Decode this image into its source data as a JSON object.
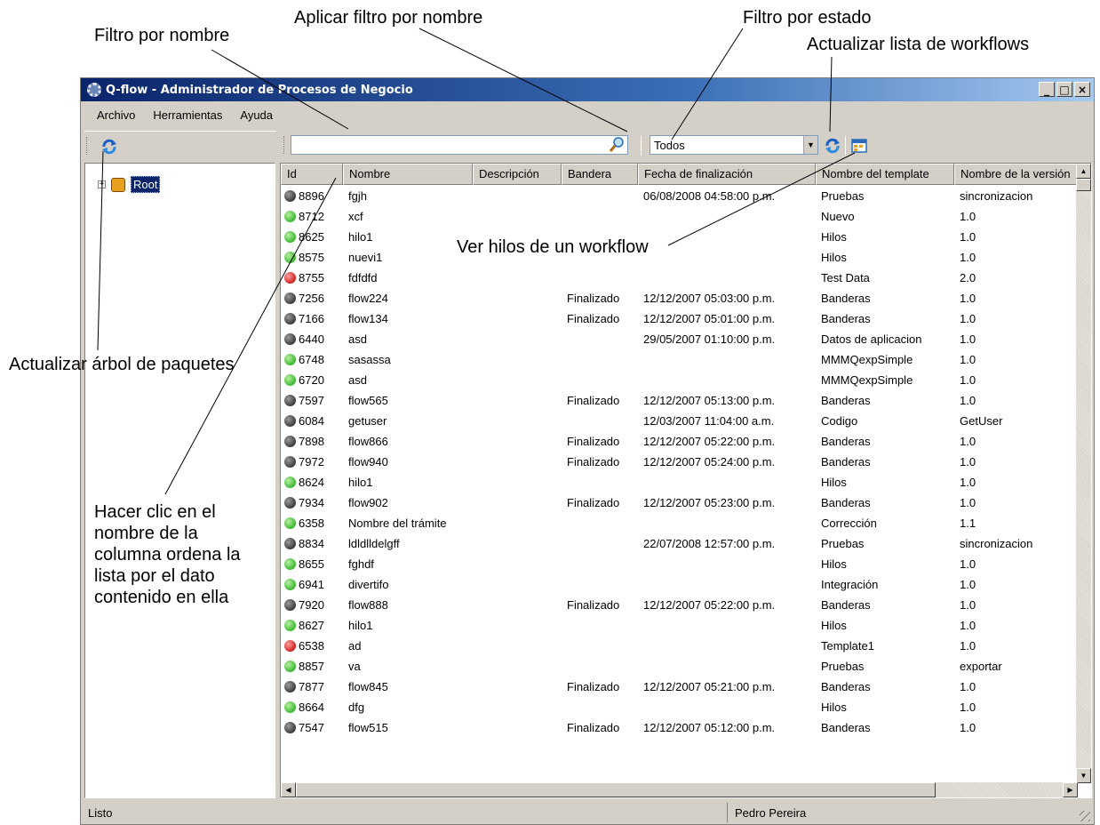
{
  "annotations": {
    "filter_by_name": "Filtro por nombre",
    "apply_name_filter": "Aplicar filtro por nombre",
    "filter_by_state": "Filtro por estado",
    "refresh_workflows": "Actualizar lista de workflows",
    "view_threads": "Ver hilos de un workflow",
    "refresh_tree": "Actualizar árbol de paquetes",
    "sort_hint": "Hacer clic en el nombre de la columna ordena la lista por el dato contenido en ella"
  },
  "window": {
    "title": "Q-flow - Administrador de Procesos de Negocio",
    "buttons": [
      "_",
      "□",
      "×"
    ]
  },
  "menu": [
    "Archivo",
    "Herramientas",
    "Ayuda"
  ],
  "toolbar": {
    "filter_value": "",
    "state_selected": "Todos"
  },
  "tree": {
    "root_label": "Root"
  },
  "grid": {
    "columns": [
      "Id",
      "Nombre",
      "Descripción",
      "Bandera",
      "Fecha de finalización",
      "Nombre del template",
      "Nombre de la versión"
    ],
    "rows": [
      {
        "status": "gray",
        "id": "8896",
        "nombre": "fgjh",
        "descripcion": "",
        "bandera": "",
        "fecha": "06/08/2008 04:58:00 p.m.",
        "template": "Pruebas",
        "version": "sincronizacion"
      },
      {
        "status": "green",
        "id": "8712",
        "nombre": "xcf",
        "descripcion": "",
        "bandera": "",
        "fecha": "",
        "template": "Nuevo",
        "version": "1.0"
      },
      {
        "status": "green",
        "id": "8625",
        "nombre": "hilo1",
        "descripcion": "",
        "bandera": "",
        "fecha": "",
        "template": "Hilos",
        "version": "1.0"
      },
      {
        "status": "green",
        "id": "8575",
        "nombre": "nuevi1",
        "descripcion": "",
        "bandera": "",
        "fecha": "",
        "template": "Hilos",
        "version": "1.0"
      },
      {
        "status": "red",
        "id": "8755",
        "nombre": "fdfdfd",
        "descripcion": "",
        "bandera": "",
        "fecha": "",
        "template": "Test Data",
        "version": "2.0"
      },
      {
        "status": "gray",
        "id": "7256",
        "nombre": "flow224",
        "descripcion": "",
        "bandera": "Finalizado",
        "fecha": "12/12/2007 05:03:00 p.m.",
        "template": "Banderas",
        "version": "1.0"
      },
      {
        "status": "gray",
        "id": "7166",
        "nombre": "flow134",
        "descripcion": "",
        "bandera": "Finalizado",
        "fecha": "12/12/2007 05:01:00 p.m.",
        "template": "Banderas",
        "version": "1.0"
      },
      {
        "status": "gray",
        "id": "6440",
        "nombre": "asd",
        "descripcion": "",
        "bandera": "",
        "fecha": "29/05/2007 01:10:00 p.m.",
        "template": "Datos de aplicacion",
        "version": "1.0"
      },
      {
        "status": "green",
        "id": "6748",
        "nombre": "sasassa",
        "descripcion": "",
        "bandera": "",
        "fecha": "",
        "template": "MMMQexpSimple",
        "version": "1.0"
      },
      {
        "status": "green",
        "id": "6720",
        "nombre": "asd",
        "descripcion": "",
        "bandera": "",
        "fecha": "",
        "template": "MMMQexpSimple",
        "version": "1.0"
      },
      {
        "status": "gray",
        "id": "7597",
        "nombre": "flow565",
        "descripcion": "",
        "bandera": "Finalizado",
        "fecha": "12/12/2007 05:13:00 p.m.",
        "template": "Banderas",
        "version": "1.0"
      },
      {
        "status": "gray",
        "id": "6084",
        "nombre": "getuser",
        "descripcion": "",
        "bandera": "",
        "fecha": "12/03/2007 11:04:00 a.m.",
        "template": "Codigo",
        "version": "GetUser"
      },
      {
        "status": "gray",
        "id": "7898",
        "nombre": "flow866",
        "descripcion": "",
        "bandera": "Finalizado",
        "fecha": "12/12/2007 05:22:00 p.m.",
        "template": "Banderas",
        "version": "1.0"
      },
      {
        "status": "gray",
        "id": "7972",
        "nombre": "flow940",
        "descripcion": "",
        "bandera": "Finalizado",
        "fecha": "12/12/2007 05:24:00 p.m.",
        "template": "Banderas",
        "version": "1.0"
      },
      {
        "status": "green",
        "id": "8624",
        "nombre": "hilo1",
        "descripcion": "",
        "bandera": "",
        "fecha": "",
        "template": "Hilos",
        "version": "1.0"
      },
      {
        "status": "gray",
        "id": "7934",
        "nombre": "flow902",
        "descripcion": "",
        "bandera": "Finalizado",
        "fecha": "12/12/2007 05:23:00 p.m.",
        "template": "Banderas",
        "version": "1.0"
      },
      {
        "status": "green",
        "id": "6358",
        "nombre": "Nombre del trámite",
        "descripcion": "",
        "bandera": "",
        "fecha": "",
        "template": "Corrección",
        "version": "1.1"
      },
      {
        "status": "gray",
        "id": "8834",
        "nombre": "ldldlldelgff",
        "descripcion": "",
        "bandera": "",
        "fecha": "22/07/2008 12:57:00 p.m.",
        "template": "Pruebas",
        "version": "sincronizacion"
      },
      {
        "status": "green",
        "id": "8655",
        "nombre": "fghdf",
        "descripcion": "",
        "bandera": "",
        "fecha": "",
        "template": "Hilos",
        "version": "1.0"
      },
      {
        "status": "green",
        "id": "6941",
        "nombre": "divertifo",
        "descripcion": "",
        "bandera": "",
        "fecha": "",
        "template": "Integración",
        "version": "1.0"
      },
      {
        "status": "gray",
        "id": "7920",
        "nombre": "flow888",
        "descripcion": "",
        "bandera": "Finalizado",
        "fecha": "12/12/2007 05:22:00 p.m.",
        "template": "Banderas",
        "version": "1.0"
      },
      {
        "status": "green",
        "id": "8627",
        "nombre": "hilo1",
        "descripcion": "",
        "bandera": "",
        "fecha": "",
        "template": "Hilos",
        "version": "1.0"
      },
      {
        "status": "red",
        "id": "6538",
        "nombre": "ad",
        "descripcion": "",
        "bandera": "",
        "fecha": "",
        "template": "Template1",
        "version": "1.0"
      },
      {
        "status": "green",
        "id": "8857",
        "nombre": "va",
        "descripcion": "",
        "bandera": "",
        "fecha": "",
        "template": "Pruebas",
        "version": "exportar"
      },
      {
        "status": "gray",
        "id": "7877",
        "nombre": "flow845",
        "descripcion": "",
        "bandera": "Finalizado",
        "fecha": "12/12/2007 05:21:00 p.m.",
        "template": "Banderas",
        "version": "1.0"
      },
      {
        "status": "green",
        "id": "8664",
        "nombre": "dfg",
        "descripcion": "",
        "bandera": "",
        "fecha": "",
        "template": "Hilos",
        "version": "1.0"
      },
      {
        "status": "gray",
        "id": "7547",
        "nombre": "flow515",
        "descripcion": "",
        "bandera": "Finalizado",
        "fecha": "12/12/2007 05:12:00 p.m.",
        "template": "Banderas",
        "version": "1.0"
      }
    ]
  },
  "status": {
    "left": "Listo",
    "user": "Pedro Pereira"
  },
  "colors": {
    "title_start": "#0a246a",
    "status_gray": "#3c3c3c",
    "status_green": "#3cb832",
    "status_red": "#d02020"
  }
}
